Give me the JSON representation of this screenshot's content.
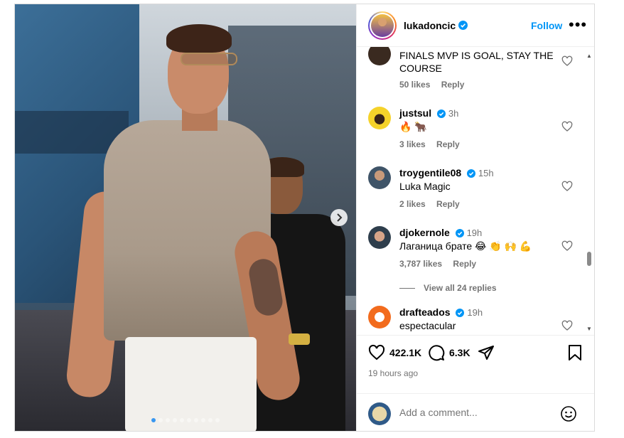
{
  "post": {
    "username": "lukadoncic",
    "follow_label": "Follow",
    "more_icon": "more-horizontal-icon",
    "carousel": {
      "total_slides": 10,
      "active_index": 0
    }
  },
  "comments": [
    {
      "partial": true,
      "text": "FINALS MVP IS GOAL, STAY THE COURSE",
      "likes": "50 likes",
      "reply": "Reply"
    },
    {
      "username": "justsul",
      "verified": true,
      "time": "3h",
      "text": "🔥 🐂",
      "likes": "3 likes",
      "reply": "Reply"
    },
    {
      "username": "troygentile08",
      "verified": true,
      "time": "15h",
      "text": "Luka Magic",
      "likes": "2 likes",
      "reply": "Reply"
    },
    {
      "username": "djokernole",
      "verified": true,
      "time": "19h",
      "text": "Лаганица брате 😂 👏 🙌 💪",
      "likes": "3,787 likes",
      "reply": "Reply",
      "view_replies": "View all 24 replies"
    },
    {
      "username": "drafteados",
      "verified": true,
      "time": "19h",
      "text": "espectacular"
    }
  ],
  "actions": {
    "likes_count": "422.1K",
    "comments_count": "6.3K",
    "timestamp": "19 hours ago"
  },
  "add_comment": {
    "placeholder": "Add a comment..."
  },
  "colors": {
    "accent": "#0095f6",
    "verified": "#0095f6",
    "muted": "#737373"
  }
}
